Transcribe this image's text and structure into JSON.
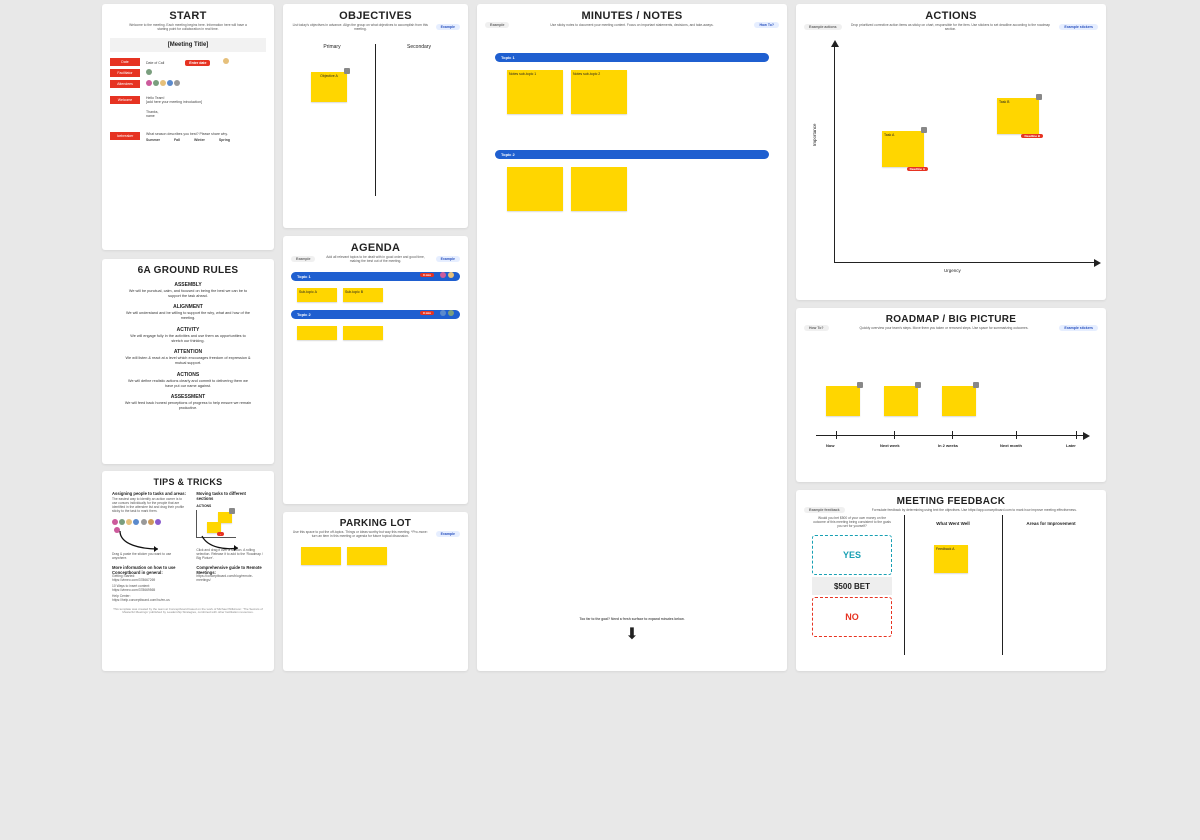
{
  "start": {
    "title": "START",
    "subtitle": "Welcome to the meeting. Each meeting begins here. Information here will have a starting point for collaboration in real time.",
    "meeting_title": "[Meeting Title]",
    "date_label": "Date",
    "date_value": "Date of Call",
    "enter_date": "Enter date",
    "facilitator_label": "Facilitator",
    "attendees_label": "Attendees",
    "welcome_label": "Welcome",
    "welcome_line1": "Hello Team!",
    "welcome_line2": "[add here your meeting introduction]",
    "welcome_line3": "Thanks,",
    "welcome_line4": "name",
    "icebreaker_label": "Icebreaker",
    "icebreaker_q": "What season describes you best? Please share why.",
    "seasons": [
      "Summer",
      "Fall",
      "Winter",
      "Spring"
    ]
  },
  "rules": {
    "title": "6A GROUND RULES",
    "items": [
      {
        "h": "ASSEMBLY",
        "t": "We will be punctual, calm, and focused on being the best we can be to support the task ahead."
      },
      {
        "h": "ALIGNMENT",
        "t": "We will understand and be willing to support the why, what and how of the meeting."
      },
      {
        "h": "ACTIVITY",
        "t": "We will engage fully in the activities and use them as opportunities to stretch our thinking."
      },
      {
        "h": "ATTENTION",
        "t": "We will listen & react at a level which encourages freedom of expression & mutual support."
      },
      {
        "h": "ACTIONS",
        "t": "We will define realistic actions clearly and commit to delivering them we have put our name against."
      },
      {
        "h": "ASSESSMENT",
        "t": "We will feed back honest perceptions of progress to help ensure we remain productive."
      }
    ]
  },
  "tips": {
    "title": "TIPS & TRICKS",
    "assign_h": "Assigning people to tasks and areas:",
    "assign_body": "The easiest way to identify an action owner is to use cursors individually for the people that are identified in the attendee list and drag their profile sticky to the task to mark them.",
    "assign_body2": "Drag & paste the sticker you want to use anywhere.",
    "move_h": "Moving tasks to different sections",
    "move_body": "Click and drag it over a section. A rolling selection. Release it to add to the 'Roadmap / Big Picture'.",
    "actions_label": "ACTIONS",
    "links_h": "More information on how to use Conceptboard in general:",
    "l1_label": "Getting Started:",
    "l1": "https://vimeo.com/378667269",
    "l2_label": "10 Ways to insert content:",
    "l2": "https://vimeo.com/378669565",
    "l3_label": "Help Center:",
    "l3": "https://help.conceptboard.com/hc/en-us",
    "guide_h": "Comprehensive guide to Remote Meetings:",
    "guide_link": "https://conceptboard.com/blog/remote-meetings/",
    "footer": "This template was created by the team at Conceptboard based on the work of Michael Wilkinson: 'The Secrets of Masterful Meetings' published by Leadership Strategies, combined with other facilitation resources."
  },
  "objectives": {
    "title": "OBJECTIVES",
    "subtitle": "List today's objectives in advance. Align the group on what objectives to accomplish from this meeting.",
    "example": "Example",
    "primary": "Primary",
    "secondary": "Secondary",
    "obj_a": "Objective A"
  },
  "agenda": {
    "title": "AGENDA",
    "subtitle": "Add all relevant topics to be dealt with in good order and good time, making the best out of the meeting.",
    "example": "Example",
    "topic1": "Topic 1",
    "topic2": "Topic 2",
    "time": "X min",
    "sub_a": "Sub-topic A",
    "sub_b": "Sub-topic B"
  },
  "parking": {
    "title": "PARKING LOT",
    "subtitle": "Use this space to put the off-topics. Things or ideas worthy but way this meeting. *Pro-move: turn an item in this meeting or agenda for future topical discussion.",
    "example": "Example"
  },
  "minutes": {
    "title": "MINUTES / NOTES",
    "subtitle": "Use sticky notes to document your meeting content. Focus on important statements, decisions, and take-aways.",
    "example": "Example",
    "howto": "How To?",
    "topic1": "Topic 1",
    "topic2": "Topic 2",
    "sub1": "Notes sub-topic 1",
    "sub2": "Notes sub-topic 2",
    "bottom_note": "Too far to the goal? Need a fresh surface to expand minutes below.",
    "arrow": "▼"
  },
  "actions": {
    "title": "ACTIONS",
    "subtitle": "Drop prioritized corrective action items as sticky on chart, responsible for the item. Use stickers to set deadline according to the roadmap section.",
    "example": "Example actions",
    "example_stickers": "Example stickers",
    "ylabel": "Importance",
    "xlabel": "Urgency",
    "taskA": "Task A",
    "taskB": "Task B",
    "d1": "Deadline A",
    "d2": "Deadline B"
  },
  "roadmap": {
    "title": "ROADMAP / BIG PICTURE",
    "subtitle": "Quickly overview your team's steps. Move them you taken or removed steps. Use space for summarizing outcomes.",
    "howto": "How To?",
    "stickers": "Example stickers",
    "ticks": [
      "Now",
      "Next week",
      "In 2 weeks",
      "Next month",
      "Later"
    ]
  },
  "feedback": {
    "title": "MEETING FEEDBACK",
    "subtitle": "Formulate feedback by determining using text the objectives. Use https://app.conceptboard.com to mark how improve meeting effectiveness.",
    "example": "Example feedback",
    "bet_label": "Would you bet $500 of your own money on the outcome of this meeting being consistent to the goals you set for yourself?",
    "yes": "YES",
    "bet": "$500 BET",
    "no": "NO",
    "well": "What Went Well",
    "improve": "Areas for Improvement",
    "fb_a": "Feedback A"
  }
}
